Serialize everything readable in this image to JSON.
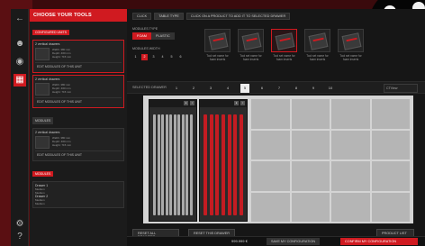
{
  "sidebar_rail": {
    "icons": [
      "back-arrow-icon",
      "user-icon",
      "palette-icon",
      "toolbox-icon",
      "settings-icon",
      "help-icon"
    ]
  },
  "panel": {
    "title": "CHOOSE YOUR TOOLS",
    "units_tag": "CONFIGURED UNITS",
    "cards": [
      {
        "name": "2 vertical drawers",
        "specs": [
          "Width: 380 mm",
          "Depth: 460 mm",
          "Height: 715 mm"
        ],
        "edit": "EDIT MODULES OF THIS UNIT"
      },
      {
        "name": "2 vertical drawers",
        "specs": [
          "Width: 380 mm",
          "Depth: 460 mm",
          "Height: 715 mm"
        ],
        "edit": "EDIT MODULES OF THIS UNIT"
      },
      {
        "name": "2 vertical drawers",
        "specs": [
          "Width: 380 mm",
          "Depth: 460 mm",
          "Height: 715 mm"
        ],
        "edit": "EDIT MODULES OF THIS UNIT"
      }
    ],
    "modules_button": "MODULES",
    "bottom_tag": "MODULES",
    "drawer_list": [
      {
        "label": "Drawer 1",
        "sub": [
          "Medium",
          "Medium"
        ]
      },
      {
        "label": "Drawer 2",
        "sub": [
          "Medium",
          "Medium"
        ]
      }
    ]
  },
  "main": {
    "breadcrumbs": [
      "CLICK",
      "TABLE TYPE",
      "CLICK ON A PRODUCT TO ADD IT TO SELECTED DRAWER"
    ],
    "modules_type_label": "MODULES TYPE",
    "tabs": [
      "FOAM",
      "PLASTIC"
    ],
    "modules_width_label": "MODULES WIDTH",
    "widths": [
      "1",
      "2",
      "3",
      "4",
      "5",
      "6"
    ],
    "products": [
      {
        "label": "Tool set name for foam inserts"
      },
      {
        "label": "Tool set name for foam inserts"
      },
      {
        "label": "Tool set name for foam inserts"
      },
      {
        "label": "Tool set name for foam inserts"
      },
      {
        "label": "Tool set name for foam inserts"
      }
    ],
    "selected_drawer_label": "SELECTED DRAWER",
    "pages": [
      "1",
      "2",
      "3",
      "4",
      "5",
      "6",
      "7",
      "8",
      "9",
      "10"
    ],
    "active_page": "5",
    "view_label": "CTView",
    "reset_all": "RESET ALL DRAWERS",
    "reset_drawer": "RESET THIS DRAWER",
    "product_list": "PRODUCT LIST",
    "price": "999.999 €",
    "save": "SAVE MY CONFIGURATION",
    "confirm": "CONFIRM MY CONFIGURATION"
  },
  "colors": {
    "accent": "#d01a20",
    "bg": "#111111",
    "stage": "#d4d4d4"
  }
}
